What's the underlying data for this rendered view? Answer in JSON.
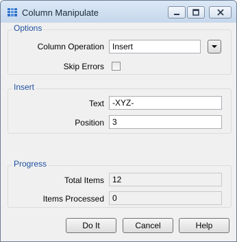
{
  "window": {
    "title": "Column Manipulate",
    "colors": {
      "titlebar": "#c6d7ec",
      "group_title": "#1e50a0",
      "body": "#f0f0f0"
    }
  },
  "options": {
    "group_title": "Options",
    "column_operation_label": "Column Operation",
    "column_operation_value": "Insert",
    "skip_errors_label": "Skip Errors",
    "skip_errors_checked": false
  },
  "insert": {
    "group_title": "Insert",
    "text_label": "Text",
    "text_value": "-XYZ-",
    "position_label": "Position",
    "position_value": "3"
  },
  "progress": {
    "group_title": "Progress",
    "total_items_label": "Total Items",
    "total_items_value": "12",
    "items_processed_label": "Items Processed",
    "items_processed_value": "0"
  },
  "buttons": {
    "do_it": "Do It",
    "cancel": "Cancel",
    "help": "Help"
  },
  "icons": {
    "app": "grid-icon",
    "minimize": "minimize-icon",
    "maximize": "maximize-icon",
    "close": "close-icon",
    "dropdown": "chevron-down-icon"
  }
}
